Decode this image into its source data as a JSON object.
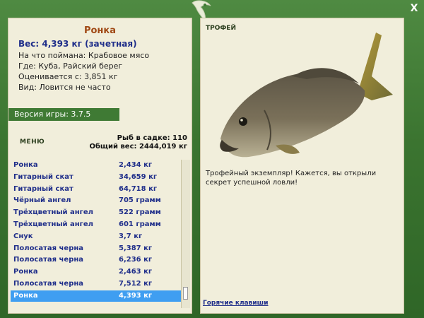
{
  "window": {
    "close_glyph": "X"
  },
  "fish": {
    "title": "Ронка",
    "weight_line": "Вес: 4,393 кг (зачетная)",
    "bait": "На что поймана: Крабовое мясо",
    "where": "Где: Куба, Райский берег",
    "price": "Оценивается с: 3,851 кг",
    "kind": "Вид: Ловится не часто"
  },
  "version": "Версия игры: 3.7.5",
  "menu_label": "МЕНЮ",
  "stats": {
    "count": "Рыб в садке: 110",
    "total": "Общий вес: 2444,019 кг"
  },
  "catch_list": [
    {
      "name": "Ронка",
      "weight": "2,434 кг"
    },
    {
      "name": "Гитарный скат",
      "weight": "34,659 кг"
    },
    {
      "name": "Гитарный скат",
      "weight": "64,718 кг"
    },
    {
      "name": "Чёрный ангел",
      "weight": "705 грамм"
    },
    {
      "name": "Трёхцветный ангел",
      "weight": "522 грамм"
    },
    {
      "name": "Трёхцветный ангел",
      "weight": "601 грамм"
    },
    {
      "name": "Снук",
      "weight": "3,7 кг"
    },
    {
      "name": "Полосатая черна",
      "weight": "5,387 кг"
    },
    {
      "name": "Полосатая черна",
      "weight": "6,236 кг"
    },
    {
      "name": "Ронка",
      "weight": "2,463 кг"
    },
    {
      "name": "Полосатая черна",
      "weight": "7,512 кг"
    },
    {
      "name": "Ронка",
      "weight": "4,393 кг"
    }
  ],
  "trophy": {
    "label": "ТРОФЕЙ",
    "text": "Трофейный экземпляр! Кажется, вы открыли секрет успешной ловли!"
  },
  "hotkeys_label": "Горячие клавиши",
  "colors": {
    "frame": "#3f7a34",
    "panel": "#f1eedb",
    "title": "#a04814",
    "accent": "#1f2e8a",
    "selection": "#3f9ef1"
  }
}
